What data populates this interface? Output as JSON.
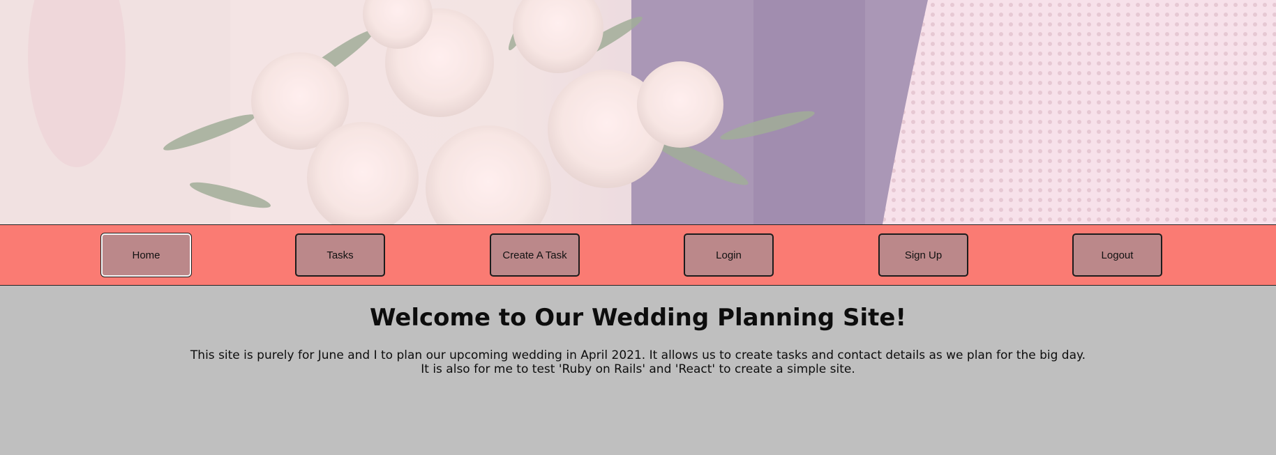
{
  "nav": {
    "items": [
      {
        "label": "Home"
      },
      {
        "label": "Tasks"
      },
      {
        "label": "Create A Task"
      },
      {
        "label": "Login"
      },
      {
        "label": "Sign Up"
      },
      {
        "label": "Logout"
      }
    ]
  },
  "main": {
    "heading": "Welcome to Our Wedding Planning Site!",
    "description_line1": "This site is purely for June and I to plan our upcoming wedding in April 2021. It allows us to create tasks and contact details as we plan for the big day.",
    "description_line2": "It is also for me to test 'Ruby on Rails' and 'React' to create a simple site."
  },
  "colors": {
    "nav_background": "#fa7b73",
    "button_background": "#bb888a",
    "page_background": "#bfbfbf"
  }
}
